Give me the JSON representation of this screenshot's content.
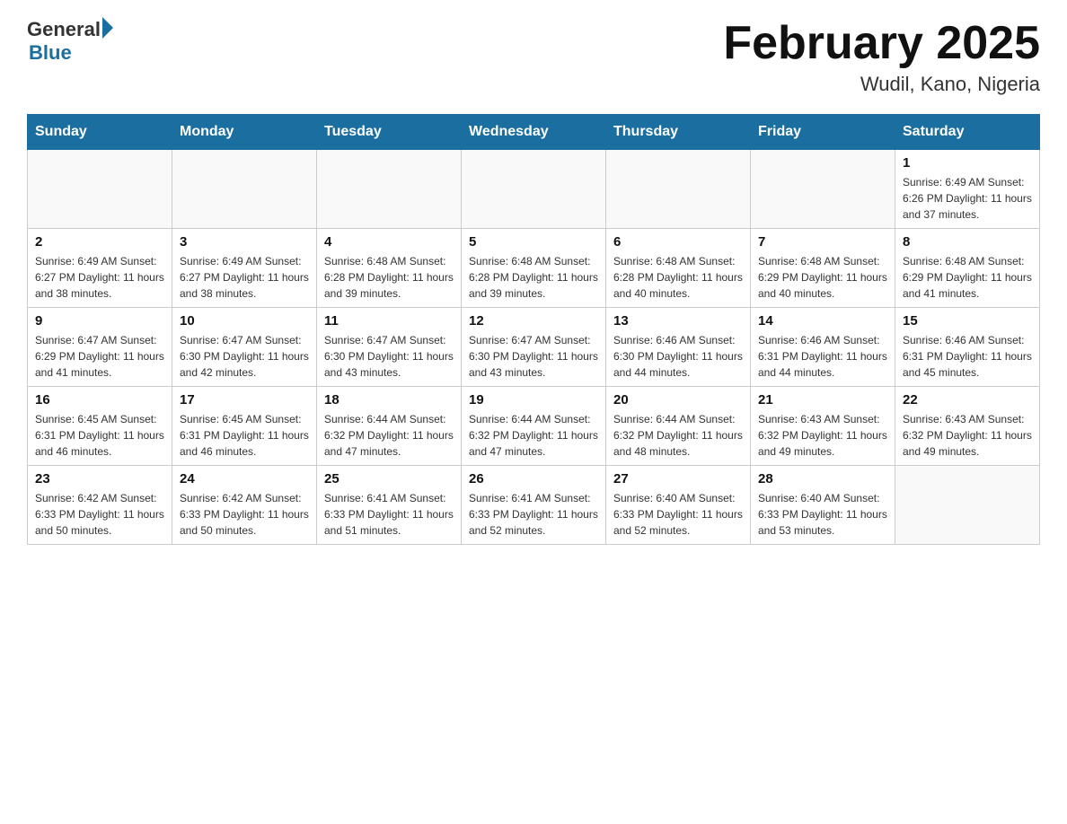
{
  "header": {
    "logo_general": "General",
    "logo_blue": "Blue",
    "month_title": "February 2025",
    "location": "Wudil, Kano, Nigeria"
  },
  "weekdays": [
    "Sunday",
    "Monday",
    "Tuesday",
    "Wednesday",
    "Thursday",
    "Friday",
    "Saturday"
  ],
  "weeks": [
    [
      {
        "day": "",
        "info": ""
      },
      {
        "day": "",
        "info": ""
      },
      {
        "day": "",
        "info": ""
      },
      {
        "day": "",
        "info": ""
      },
      {
        "day": "",
        "info": ""
      },
      {
        "day": "",
        "info": ""
      },
      {
        "day": "1",
        "info": "Sunrise: 6:49 AM\nSunset: 6:26 PM\nDaylight: 11 hours and 37 minutes."
      }
    ],
    [
      {
        "day": "2",
        "info": "Sunrise: 6:49 AM\nSunset: 6:27 PM\nDaylight: 11 hours and 38 minutes."
      },
      {
        "day": "3",
        "info": "Sunrise: 6:49 AM\nSunset: 6:27 PM\nDaylight: 11 hours and 38 minutes."
      },
      {
        "day": "4",
        "info": "Sunrise: 6:48 AM\nSunset: 6:28 PM\nDaylight: 11 hours and 39 minutes."
      },
      {
        "day": "5",
        "info": "Sunrise: 6:48 AM\nSunset: 6:28 PM\nDaylight: 11 hours and 39 minutes."
      },
      {
        "day": "6",
        "info": "Sunrise: 6:48 AM\nSunset: 6:28 PM\nDaylight: 11 hours and 40 minutes."
      },
      {
        "day": "7",
        "info": "Sunrise: 6:48 AM\nSunset: 6:29 PM\nDaylight: 11 hours and 40 minutes."
      },
      {
        "day": "8",
        "info": "Sunrise: 6:48 AM\nSunset: 6:29 PM\nDaylight: 11 hours and 41 minutes."
      }
    ],
    [
      {
        "day": "9",
        "info": "Sunrise: 6:47 AM\nSunset: 6:29 PM\nDaylight: 11 hours and 41 minutes."
      },
      {
        "day": "10",
        "info": "Sunrise: 6:47 AM\nSunset: 6:30 PM\nDaylight: 11 hours and 42 minutes."
      },
      {
        "day": "11",
        "info": "Sunrise: 6:47 AM\nSunset: 6:30 PM\nDaylight: 11 hours and 43 minutes."
      },
      {
        "day": "12",
        "info": "Sunrise: 6:47 AM\nSunset: 6:30 PM\nDaylight: 11 hours and 43 minutes."
      },
      {
        "day": "13",
        "info": "Sunrise: 6:46 AM\nSunset: 6:30 PM\nDaylight: 11 hours and 44 minutes."
      },
      {
        "day": "14",
        "info": "Sunrise: 6:46 AM\nSunset: 6:31 PM\nDaylight: 11 hours and 44 minutes."
      },
      {
        "day": "15",
        "info": "Sunrise: 6:46 AM\nSunset: 6:31 PM\nDaylight: 11 hours and 45 minutes."
      }
    ],
    [
      {
        "day": "16",
        "info": "Sunrise: 6:45 AM\nSunset: 6:31 PM\nDaylight: 11 hours and 46 minutes."
      },
      {
        "day": "17",
        "info": "Sunrise: 6:45 AM\nSunset: 6:31 PM\nDaylight: 11 hours and 46 minutes."
      },
      {
        "day": "18",
        "info": "Sunrise: 6:44 AM\nSunset: 6:32 PM\nDaylight: 11 hours and 47 minutes."
      },
      {
        "day": "19",
        "info": "Sunrise: 6:44 AM\nSunset: 6:32 PM\nDaylight: 11 hours and 47 minutes."
      },
      {
        "day": "20",
        "info": "Sunrise: 6:44 AM\nSunset: 6:32 PM\nDaylight: 11 hours and 48 minutes."
      },
      {
        "day": "21",
        "info": "Sunrise: 6:43 AM\nSunset: 6:32 PM\nDaylight: 11 hours and 49 minutes."
      },
      {
        "day": "22",
        "info": "Sunrise: 6:43 AM\nSunset: 6:32 PM\nDaylight: 11 hours and 49 minutes."
      }
    ],
    [
      {
        "day": "23",
        "info": "Sunrise: 6:42 AM\nSunset: 6:33 PM\nDaylight: 11 hours and 50 minutes."
      },
      {
        "day": "24",
        "info": "Sunrise: 6:42 AM\nSunset: 6:33 PM\nDaylight: 11 hours and 50 minutes."
      },
      {
        "day": "25",
        "info": "Sunrise: 6:41 AM\nSunset: 6:33 PM\nDaylight: 11 hours and 51 minutes."
      },
      {
        "day": "26",
        "info": "Sunrise: 6:41 AM\nSunset: 6:33 PM\nDaylight: 11 hours and 52 minutes."
      },
      {
        "day": "27",
        "info": "Sunrise: 6:40 AM\nSunset: 6:33 PM\nDaylight: 11 hours and 52 minutes."
      },
      {
        "day": "28",
        "info": "Sunrise: 6:40 AM\nSunset: 6:33 PM\nDaylight: 11 hours and 53 minutes."
      },
      {
        "day": "",
        "info": ""
      }
    ]
  ]
}
